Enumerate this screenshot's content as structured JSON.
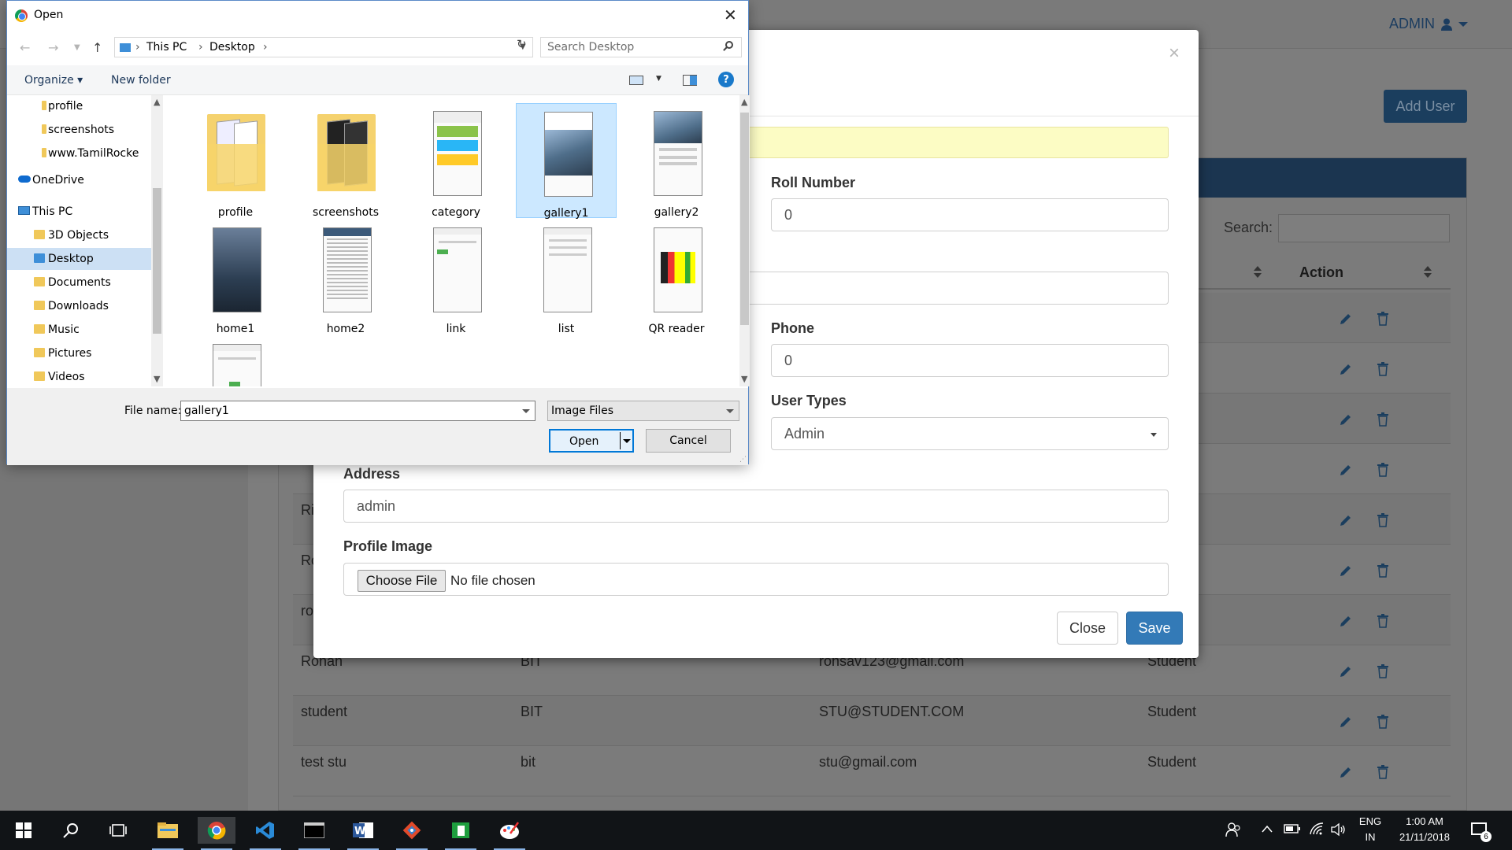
{
  "webapp": {
    "admin_label": "ADMIN",
    "add_user_label": "Add User",
    "search_label": "Search:",
    "action_header": "Action",
    "partial_cells": [
      "Ri",
      "Ro",
      "ro"
    ],
    "rows": [
      {
        "name": "Rohan",
        "dept": "BIT",
        "email": "rohsav123@gmail.com",
        "type": "Student"
      },
      {
        "name": "student",
        "dept": "BIT",
        "email": "STU@STUDENT.COM",
        "type": "Student"
      },
      {
        "name": "test stu",
        "dept": "bit",
        "email": "stu@gmail.com",
        "type": "Student"
      }
    ]
  },
  "modal": {
    "close_x": "×",
    "roll_number_label": "Roll Number",
    "roll_number_value": "0",
    "phone_label": "Phone",
    "phone_value": "0",
    "user_types_label": "User Types",
    "user_types_value": "Admin",
    "address_label": "Address",
    "address_value": "admin",
    "profile_image_label": "Profile Image",
    "choose_file_label": "Choose File",
    "no_file_text": "No file chosen",
    "close_label": "Close",
    "save_label": "Save",
    "save_color": "#337ab7"
  },
  "dialog": {
    "title": "Open",
    "close_x": "✕",
    "breadcrumb": [
      "This PC",
      "Desktop"
    ],
    "search_placeholder": "Search Desktop",
    "organize_label": "Organize",
    "new_folder_label": "New folder",
    "nav_items": [
      {
        "label": "profile",
        "icon": "folder-icon"
      },
      {
        "label": "screenshots",
        "icon": "folder-icon"
      },
      {
        "label": "www.TamilRocke",
        "icon": "folder-icon"
      },
      {
        "label": "OneDrive",
        "icon": "onedrive-icon"
      },
      {
        "label": "This PC",
        "icon": "pc-icon"
      },
      {
        "label": "3D Objects",
        "icon": "folder-icon"
      },
      {
        "label": "Desktop",
        "icon": "desktop-icon",
        "selected": true
      },
      {
        "label": "Documents",
        "icon": "folder-icon"
      },
      {
        "label": "Downloads",
        "icon": "folder-icon"
      },
      {
        "label": "Music",
        "icon": "folder-icon"
      },
      {
        "label": "Pictures",
        "icon": "folder-icon"
      },
      {
        "label": "Videos",
        "icon": "folder-icon"
      }
    ],
    "files": [
      {
        "name": "profile",
        "kind": "folder"
      },
      {
        "name": "screenshots",
        "kind": "folder"
      },
      {
        "name": "category",
        "kind": "image"
      },
      {
        "name": "gallery1",
        "kind": "image",
        "selected": true
      },
      {
        "name": "gallery2",
        "kind": "image"
      },
      {
        "name": "home1",
        "kind": "image"
      },
      {
        "name": "home2",
        "kind": "image"
      },
      {
        "name": "link",
        "kind": "image"
      },
      {
        "name": "list",
        "kind": "image"
      },
      {
        "name": "QR reader",
        "kind": "image"
      },
      {
        "name": "",
        "kind": "image"
      }
    ],
    "file_name_label": "File name:",
    "file_name_value": "gallery1",
    "file_type_value": "Image Files",
    "open_label": "Open",
    "cancel_label": "Cancel",
    "help_label": "?"
  },
  "taskbar": {
    "apps": [
      "windows-start-icon",
      "search-icon",
      "task-view-icon",
      "file-explorer-icon",
      "chrome-icon",
      "vscode-icon",
      "terminal-icon",
      "word-icon",
      "git-icon",
      "spreadsheet-icon",
      "paint-icon"
    ],
    "lang_top": "ENG",
    "lang_bottom": "IN",
    "time": "1:00 AM",
    "date": "21/11/2018",
    "notification_count": "6"
  }
}
